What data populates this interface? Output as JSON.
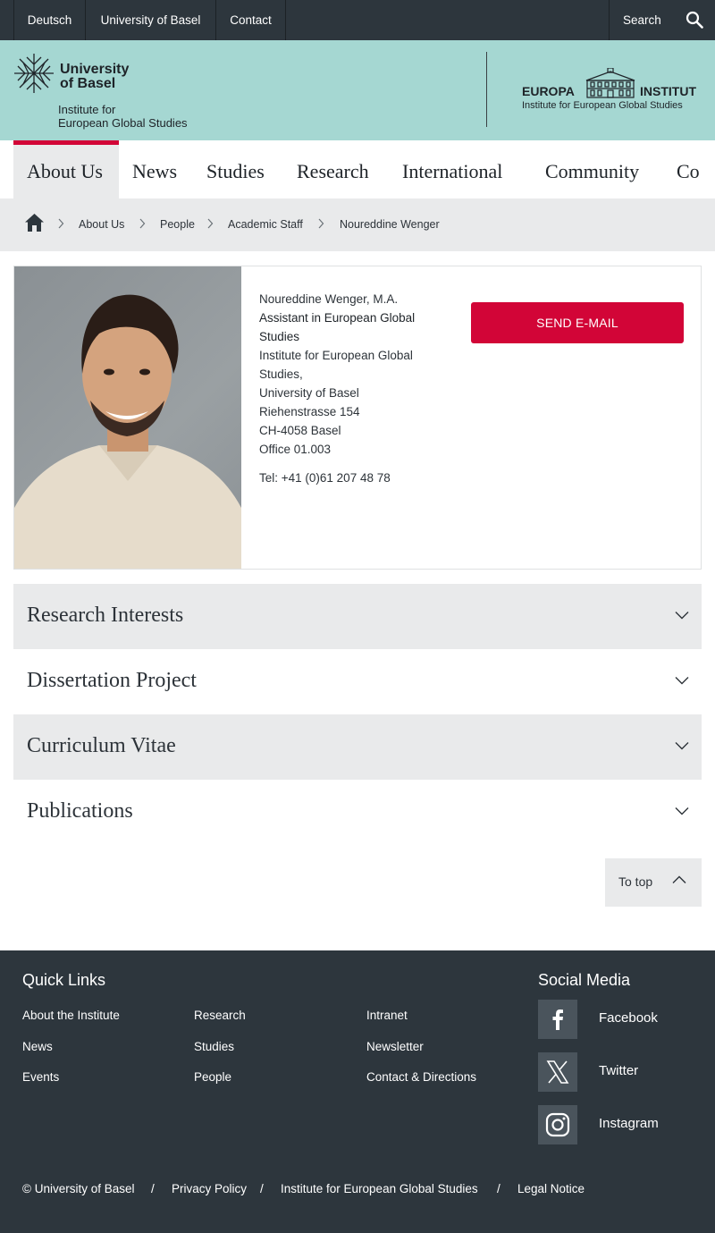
{
  "topbar": {
    "lang": "Deutsch",
    "university": "University of Basel",
    "contact": "Contact",
    "search": "Search"
  },
  "header": {
    "uni_line1": "University",
    "uni_line2": "of Basel",
    "institute_line1": "Institute for",
    "institute_line2": "European Global Studies",
    "europa_word1": "EUROPA",
    "europa_word2": "INSTITUT",
    "europa_sub": "Institute for European Global Studies"
  },
  "nav": {
    "items": [
      "About Us",
      "News",
      "Studies",
      "Research",
      "International",
      "Community",
      "Co"
    ]
  },
  "breadcrumb": {
    "items": [
      "About Us",
      "People",
      "Academic Staff",
      "Noureddine Wenger"
    ]
  },
  "profile": {
    "name": "Noureddine Wenger, M.A.",
    "role_line1": "Assistant in European Global",
    "role_line2": "Studies",
    "addr1": "Institute for European Global",
    "addr2": "Studies,",
    "addr3": "University of Basel",
    "addr4": "Riehenstrasse 154",
    "addr5": "CH-4058 Basel",
    "addr6": "Office 01.003",
    "tel": "Tel: +41 (0)61 207 48 78",
    "mail_button": "SEND E-MAIL"
  },
  "sections": [
    "Research Interests",
    "Dissertation Project",
    "Curriculum Vitae",
    "Publications"
  ],
  "totop": "To top",
  "footer": {
    "quick_links_title": "Quick Links",
    "col1": [
      "About the Institute",
      "News",
      "Events"
    ],
    "col2": [
      "Research",
      "Studies",
      "People"
    ],
    "col3": [
      "Intranet",
      "Newsletter",
      "Contact & Directions"
    ],
    "social_title": "Social Media",
    "social": [
      "Facebook",
      "Twitter",
      "Instagram"
    ],
    "bottom": [
      "© University of Basel",
      "/",
      "Privacy Policy",
      "/",
      "Institute for European Global Studies",
      "/",
      "Legal Notice"
    ]
  },
  "colors": {
    "accent_red": "#d20537",
    "header_mint": "#a5d7d2",
    "dark": "#2d363d",
    "light_grey": "#e9eaeb"
  }
}
